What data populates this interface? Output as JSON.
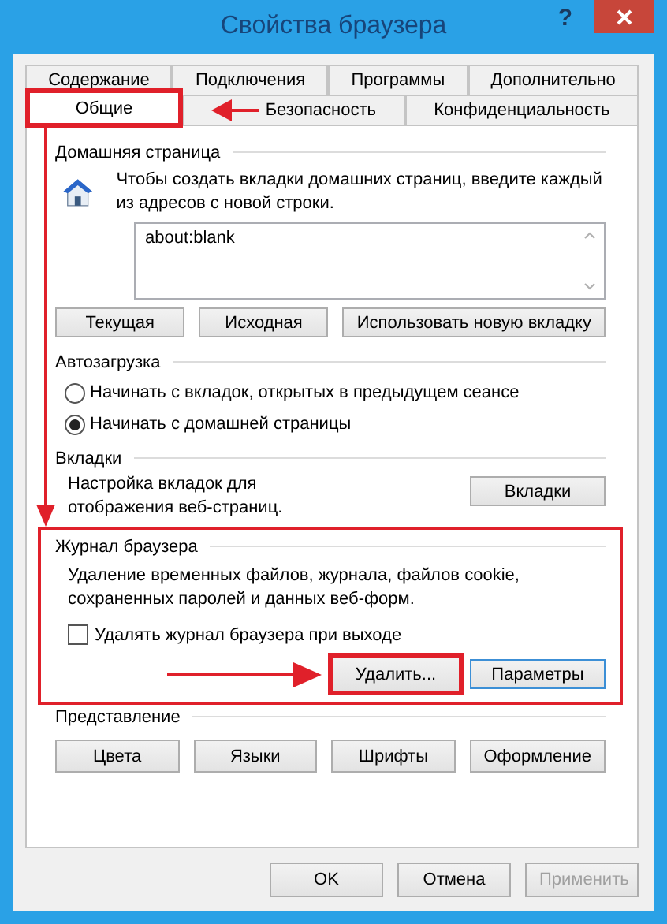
{
  "window": {
    "title": "Свойства браузера",
    "help": "?"
  },
  "tabs": [
    [
      {
        "label": "Содержание",
        "selected": false,
        "highlighted": false
      },
      {
        "label": "Подключения",
        "selected": false,
        "highlighted": false
      },
      {
        "label": "Программы",
        "selected": false,
        "highlighted": false
      },
      {
        "label": "Дополнительно",
        "selected": false,
        "highlighted": false
      }
    ],
    [
      {
        "label": "Общие",
        "selected": true,
        "highlighted": true
      },
      {
        "label": "Безопасность",
        "selected": false,
        "highlighted": false
      },
      {
        "label": "Конфиденциальность",
        "selected": false,
        "highlighted": false
      }
    ]
  ],
  "home_page": {
    "title": "Домашняя страница",
    "description": "Чтобы создать вкладки домашних страниц, введите каждый из адресов с новой строки.",
    "addresses": "about:blank",
    "buttons": [
      "Текущая",
      "Исходная",
      "Использовать новую вкладку"
    ]
  },
  "startup": {
    "title": "Автозагрузка",
    "options": [
      {
        "label": "Начинать с вкладок, открытых в предыдущем сеансе",
        "selected": false
      },
      {
        "label": "Начинать с домашней страницы",
        "selected": true
      }
    ]
  },
  "tab_settings": {
    "title": "Вкладки",
    "description": "Настройка вкладок для отображения веб-страниц.",
    "button": "Вкладки"
  },
  "history": {
    "title": "Журнал браузера",
    "highlighted": true,
    "description": "Удаление временных файлов, журнала, файлов cookie, сохраненных паролей и данных веб-форм.",
    "checkbox": {
      "label": "Удалять журнал браузера при выходе",
      "checked": false
    },
    "buttons": [
      {
        "label": "Удалить...",
        "highlighted": true,
        "focused": false
      },
      {
        "label": "Параметры",
        "highlighted": false,
        "focused": true
      }
    ]
  },
  "appearance": {
    "title": "Представление",
    "buttons": [
      "Цвета",
      "Языки",
      "Шрифты",
      "Оформление"
    ]
  },
  "footer": [
    {
      "label": "OK",
      "disabled": false
    },
    {
      "label": "Отмена",
      "disabled": false
    },
    {
      "label": "Применить",
      "disabled": true
    }
  ]
}
